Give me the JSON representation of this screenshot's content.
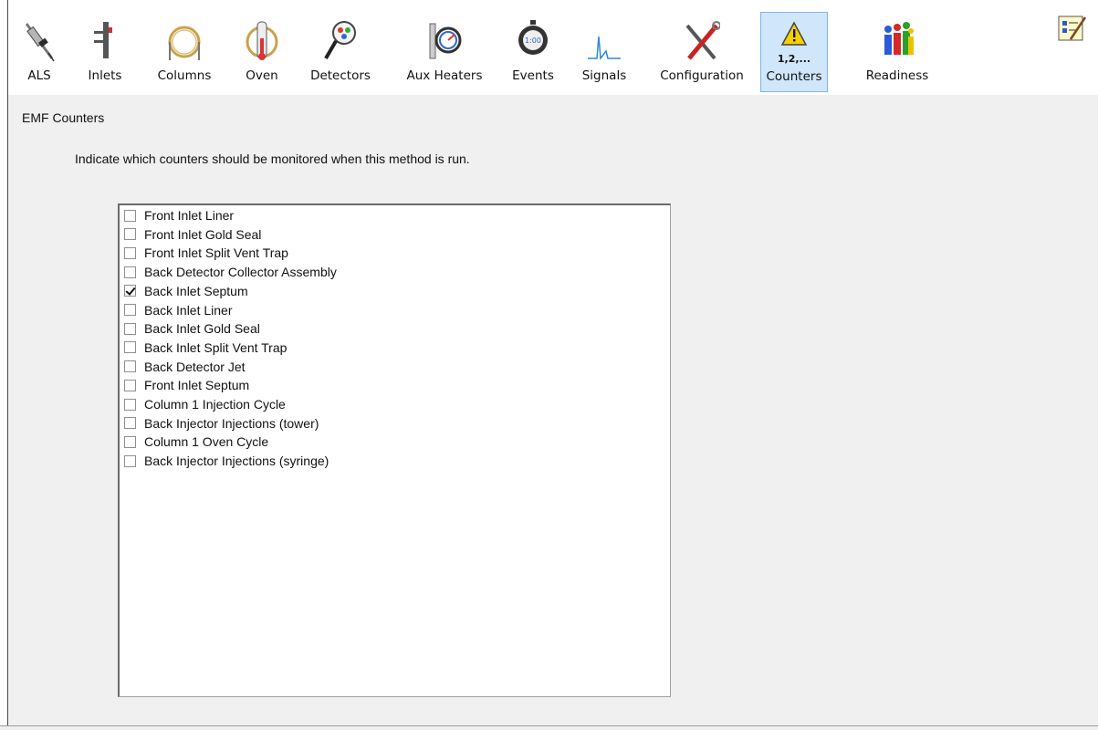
{
  "tabs": [
    {
      "label": "ALS",
      "icon": "syringe-icon"
    },
    {
      "label": "Inlets",
      "icon": "inlet-icon"
    },
    {
      "label": "Columns",
      "icon": "column-coil-icon"
    },
    {
      "label": "Oven",
      "icon": "oven-icon"
    },
    {
      "label": "Detectors",
      "icon": "detector-icon"
    },
    {
      "label": "Aux Heaters",
      "icon": "gauge-icon"
    },
    {
      "label": "Events",
      "icon": "stopwatch-icon"
    },
    {
      "label": "Signals",
      "icon": "signal-peak-icon"
    },
    {
      "label": "Configuration",
      "icon": "tools-icon"
    },
    {
      "label": "Counters",
      "icon": "warning-counter-icon",
      "icon_text": "1,2,...",
      "active": true
    },
    {
      "label": "Readiness",
      "icon": "readiness-people-icon"
    }
  ],
  "section_title": "EMF Counters",
  "instruction": "Indicate which counters should be monitored when this method is run.",
  "counters": [
    {
      "label": "Front Inlet Liner",
      "checked": false
    },
    {
      "label": "Front Inlet Gold Seal",
      "checked": false
    },
    {
      "label": "Front Inlet Split Vent Trap",
      "checked": false
    },
    {
      "label": "Back Detector Collector Assembly",
      "checked": false
    },
    {
      "label": "Back Inlet Septum",
      "checked": true
    },
    {
      "label": "Back Inlet Liner",
      "checked": false
    },
    {
      "label": "Back Inlet Gold Seal",
      "checked": false
    },
    {
      "label": "Back Inlet Split Vent Trap",
      "checked": false
    },
    {
      "label": "Back Detector Jet",
      "checked": false
    },
    {
      "label": "Front Inlet Septum",
      "checked": false
    },
    {
      "label": "Column 1 Injection Cycle",
      "checked": false
    },
    {
      "label": "Back Injector Injections (tower)",
      "checked": false
    },
    {
      "label": "Column 1 Oven Cycle",
      "checked": false
    },
    {
      "label": "Back Injector Injections (syringe)",
      "checked": false
    }
  ],
  "colors": {
    "active_tab_bg": "#cfe6fb",
    "active_tab_border": "#7fb4e6",
    "panel_bg": "#f0f0f0"
  }
}
